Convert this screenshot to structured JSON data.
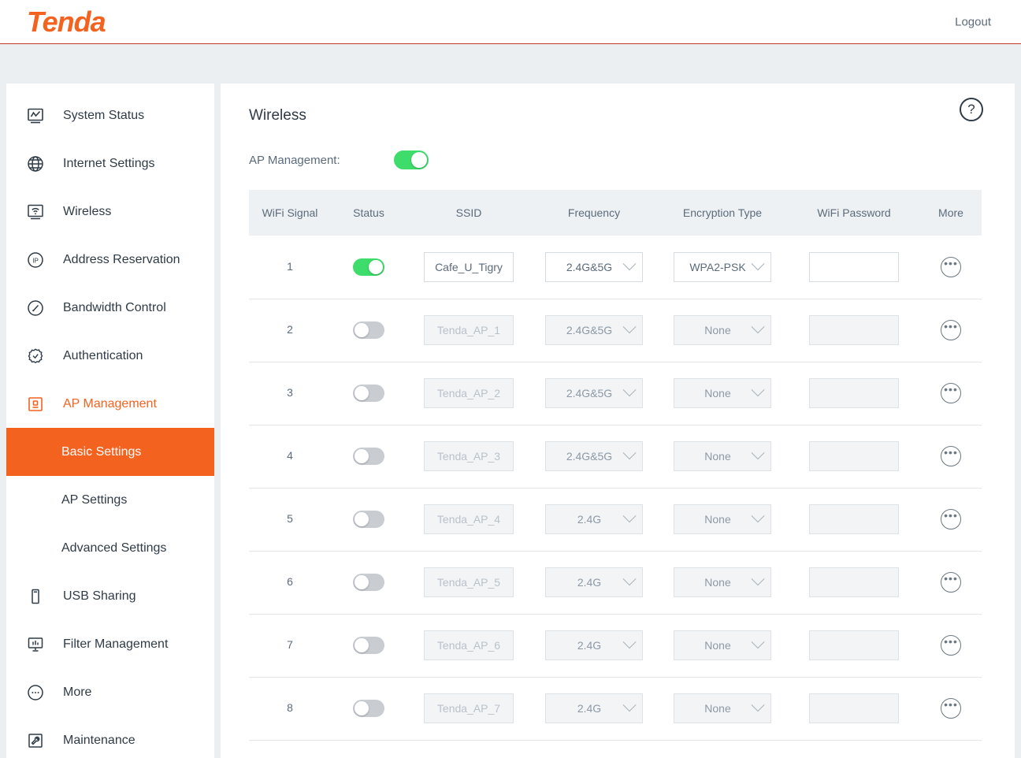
{
  "brand": {
    "name": "Tenda"
  },
  "topbar": {
    "logout_label": "Logout"
  },
  "sidebar": {
    "items": [
      {
        "label": "System Status",
        "icon": "monitor-chart-icon"
      },
      {
        "label": "Internet Settings",
        "icon": "globe-icon"
      },
      {
        "label": "Wireless",
        "icon": "wifi-screen-icon"
      },
      {
        "label": "Address Reservation",
        "icon": "ip-circle-icon"
      },
      {
        "label": "Bandwidth Control",
        "icon": "gauge-icon"
      },
      {
        "label": "Authentication",
        "icon": "verified-badge-icon"
      },
      {
        "label": "AP Management",
        "icon": "ap-device-icon"
      }
    ],
    "sub_items": [
      {
        "label": "Basic Settings"
      },
      {
        "label": "AP Settings"
      },
      {
        "label": "Advanced Settings"
      }
    ],
    "items_after": [
      {
        "label": "USB Sharing",
        "icon": "usb-drive-icon"
      },
      {
        "label": "Filter Management",
        "icon": "filter-chart-icon"
      },
      {
        "label": "More",
        "icon": "ellipsis-circle-icon"
      },
      {
        "label": "Maintenance",
        "icon": "wrench-icon"
      }
    ]
  },
  "main": {
    "title": "Wireless",
    "help_icon_label": "?",
    "ap_management": {
      "label": "AP Management:",
      "enabled": true
    },
    "table": {
      "columns": [
        "WiFi Signal",
        "Status",
        "SSID",
        "Frequency",
        "Encryption Type",
        "WiFi Password",
        "More"
      ],
      "rows": [
        {
          "signal": "1",
          "status_on": true,
          "ssid": "Cafe_U_Tigry",
          "ssid_placeholder": "",
          "frequency": "2.4G&5G",
          "encryption": "WPA2-PSK",
          "password": "",
          "more_icon": "ellipsis-circle-icon",
          "disabled": false
        },
        {
          "signal": "2",
          "status_on": false,
          "ssid": "",
          "ssid_placeholder": "Tenda_AP_1",
          "frequency": "2.4G&5G",
          "encryption": "None",
          "password": "",
          "more_icon": "ellipsis-circle-icon",
          "disabled": true
        },
        {
          "signal": "3",
          "status_on": false,
          "ssid": "",
          "ssid_placeholder": "Tenda_AP_2",
          "frequency": "2.4G&5G",
          "encryption": "None",
          "password": "",
          "more_icon": "ellipsis-circle-icon",
          "disabled": true
        },
        {
          "signal": "4",
          "status_on": false,
          "ssid": "",
          "ssid_placeholder": "Tenda_AP_3",
          "frequency": "2.4G&5G",
          "encryption": "None",
          "password": "",
          "more_icon": "ellipsis-circle-icon",
          "disabled": true
        },
        {
          "signal": "5",
          "status_on": false,
          "ssid": "",
          "ssid_placeholder": "Tenda_AP_4",
          "frequency": "2.4G",
          "encryption": "None",
          "password": "",
          "more_icon": "ellipsis-circle-icon",
          "disabled": true
        },
        {
          "signal": "6",
          "status_on": false,
          "ssid": "",
          "ssid_placeholder": "Tenda_AP_5",
          "frequency": "2.4G",
          "encryption": "None",
          "password": "",
          "more_icon": "ellipsis-circle-icon",
          "disabled": true
        },
        {
          "signal": "7",
          "status_on": false,
          "ssid": "",
          "ssid_placeholder": "Tenda_AP_6",
          "frequency": "2.4G",
          "encryption": "None",
          "password": "",
          "more_icon": "ellipsis-circle-icon",
          "disabled": true
        },
        {
          "signal": "8",
          "status_on": false,
          "ssid": "",
          "ssid_placeholder": "Tenda_AP_7",
          "frequency": "2.4G",
          "encryption": "None",
          "password": "",
          "more_icon": "ellipsis-circle-icon",
          "disabled": true
        }
      ]
    }
  },
  "colors": {
    "brand_orange": "#f4621f",
    "toggle_on_green": "#3ddc6b",
    "toggle_off_gray": "#c9cdd2",
    "page_bg": "#eceff1",
    "header_rule_red": "#c0392b",
    "text_dark": "#2f3b47",
    "text_muted": "#5c6b7a"
  }
}
